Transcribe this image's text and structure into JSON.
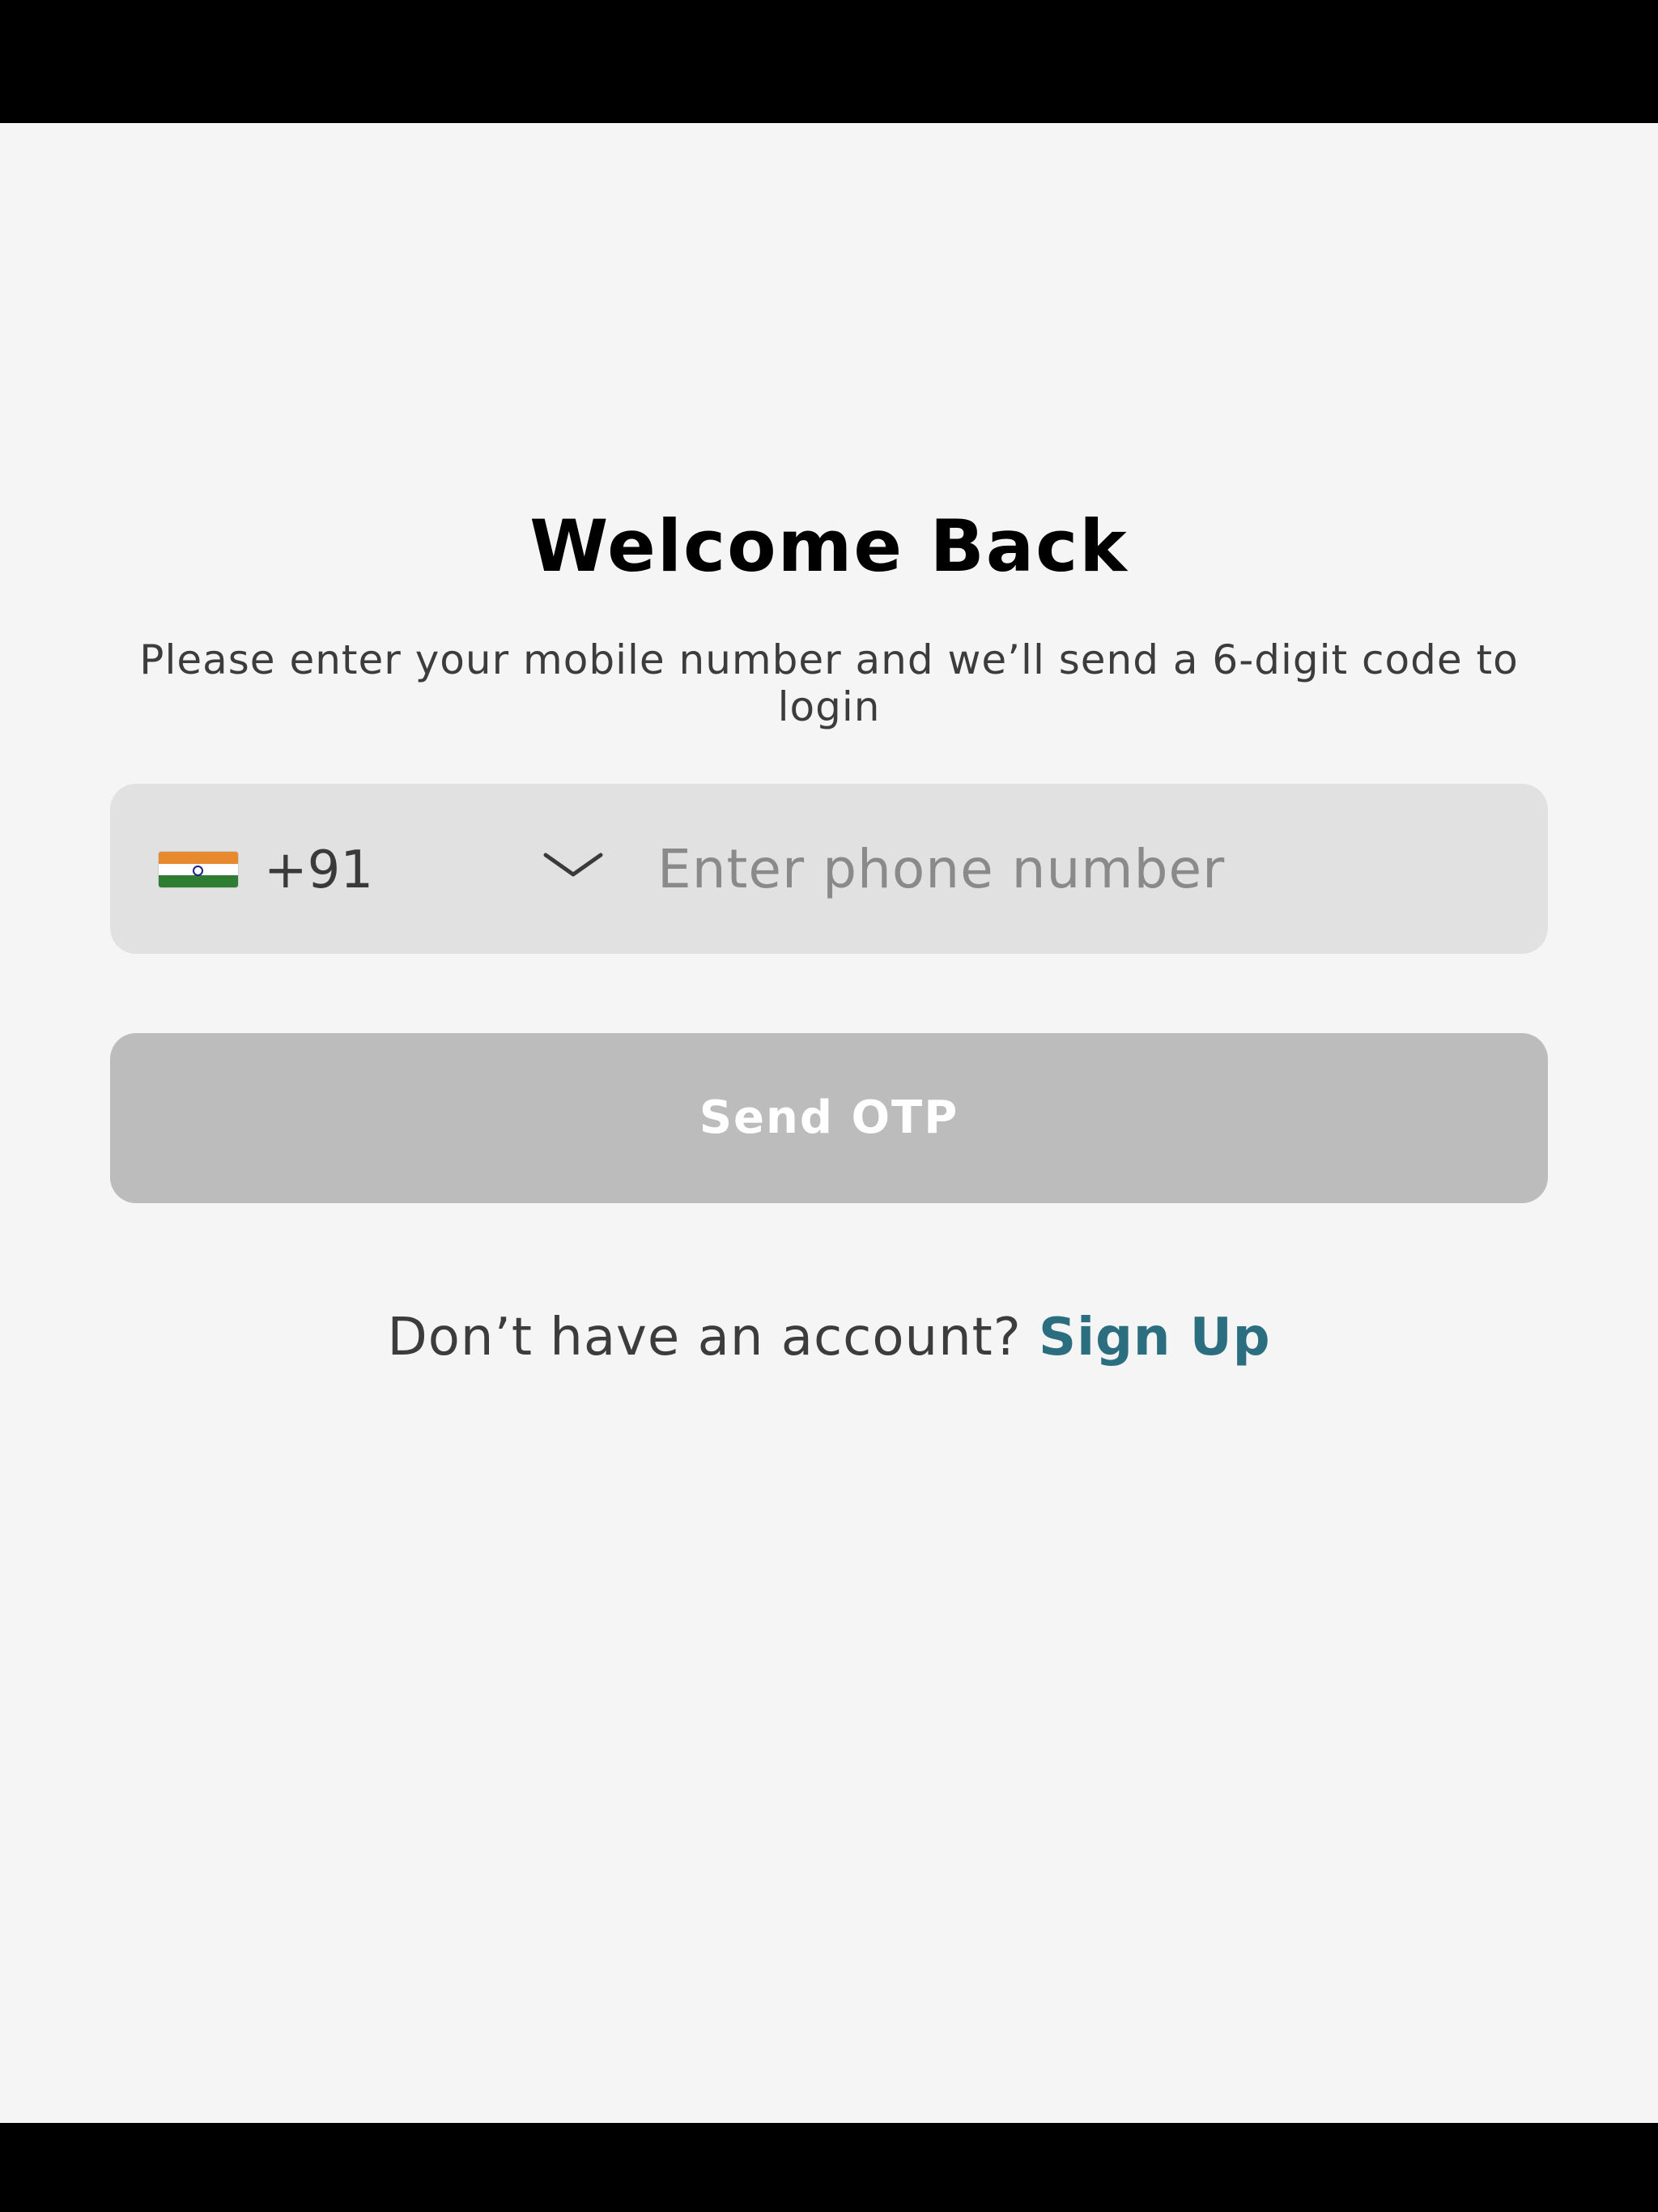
{
  "login": {
    "title": "Welcome Back",
    "subtitle": "Please enter your mobile number and we’ll send a 6-digit code to login",
    "country": {
      "flag_icon": "india-flag-icon",
      "dial_code": "+91",
      "dropdown_icon": "chevron-down-icon"
    },
    "phone_input": {
      "value": "",
      "placeholder": "Enter phone number"
    },
    "send_button_label": "Send OTP",
    "signup_prompt": "Don’t have an account?",
    "signup_link": "Sign Up"
  },
  "colors": {
    "background": "#f5f5f5",
    "field_background": "#e1e1e1",
    "button_disabled": "#bcbcbc",
    "link": "#2b6e80",
    "system_bars": "#000000"
  }
}
